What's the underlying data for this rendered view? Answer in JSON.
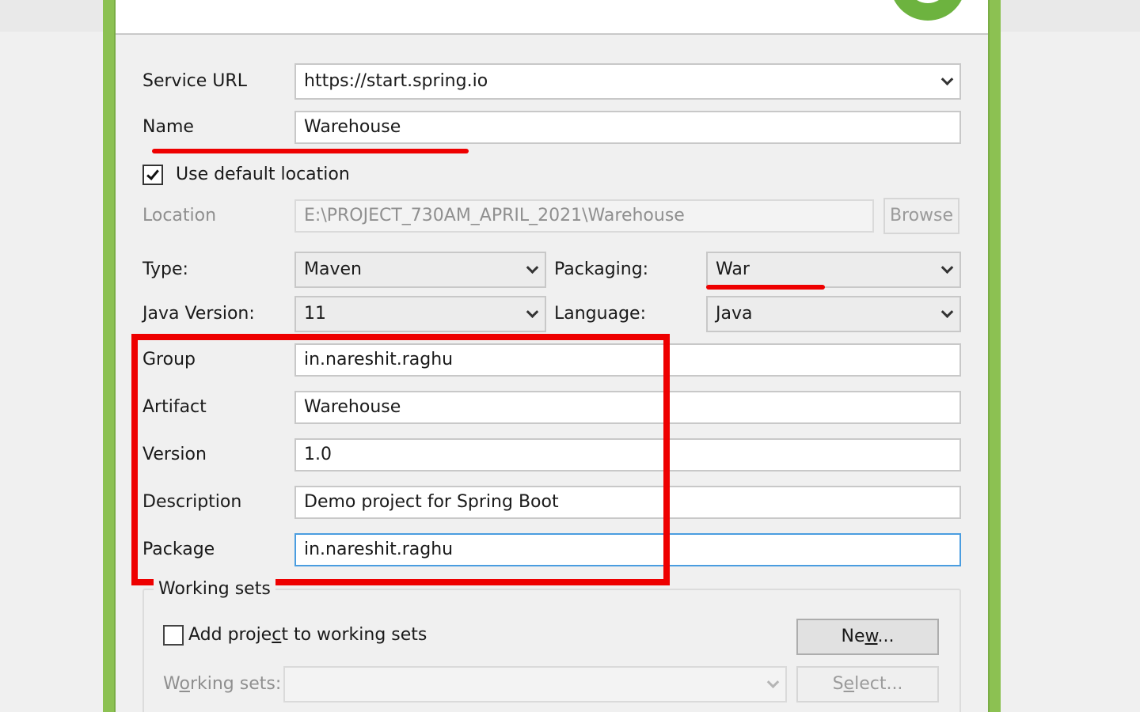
{
  "form": {
    "service_url": {
      "label": "Service URL",
      "value": "https://start.spring.io"
    },
    "name": {
      "label": "Name",
      "value": "Warehouse"
    },
    "use_default_location": {
      "label": "Use default location",
      "checked": true
    },
    "location": {
      "label": "Location",
      "value": "E:\\PROJECT_730AM_APRIL_2021\\Warehouse",
      "browse_label": "Browse"
    },
    "type": {
      "label": "Type:",
      "value": "Maven"
    },
    "packaging": {
      "label": "Packaging:",
      "value": "War"
    },
    "java_version": {
      "label": "Java Version:",
      "value": "11"
    },
    "language": {
      "label": "Language:",
      "value": "Java"
    },
    "group": {
      "label": "Group",
      "value": "in.nareshit.raghu"
    },
    "artifact": {
      "label": "Artifact",
      "value": "Warehouse"
    },
    "version": {
      "label": "Version",
      "value": "1.0"
    },
    "description": {
      "label": "Description",
      "value": "Demo project for Spring Boot"
    },
    "package": {
      "label": "Package",
      "value": "in.nareshit.raghu"
    }
  },
  "working_sets": {
    "title": "Working sets",
    "add_to_working_sets": {
      "label_before": "Add proje",
      "label_mnemonic": "c",
      "label_after": "t to working sets",
      "checked": false
    },
    "new_button": {
      "before": "Ne",
      "mnemonic": "w",
      "after": "..."
    },
    "working_sets_label": {
      "before": "W",
      "mnemonic": "o",
      "after": "rking sets:"
    },
    "working_sets_value": "",
    "select_button": {
      "before": "S",
      "mnemonic": "e",
      "after": "lect..."
    }
  },
  "colors": {
    "frame_green": "#8cc152",
    "spring_green": "#6db33f",
    "annotation_red": "#ee0000",
    "focus_blue": "#4a9de0"
  },
  "icons": [
    "spring-logo-icon",
    "chevron-down-icon",
    "checkmark-icon"
  ]
}
